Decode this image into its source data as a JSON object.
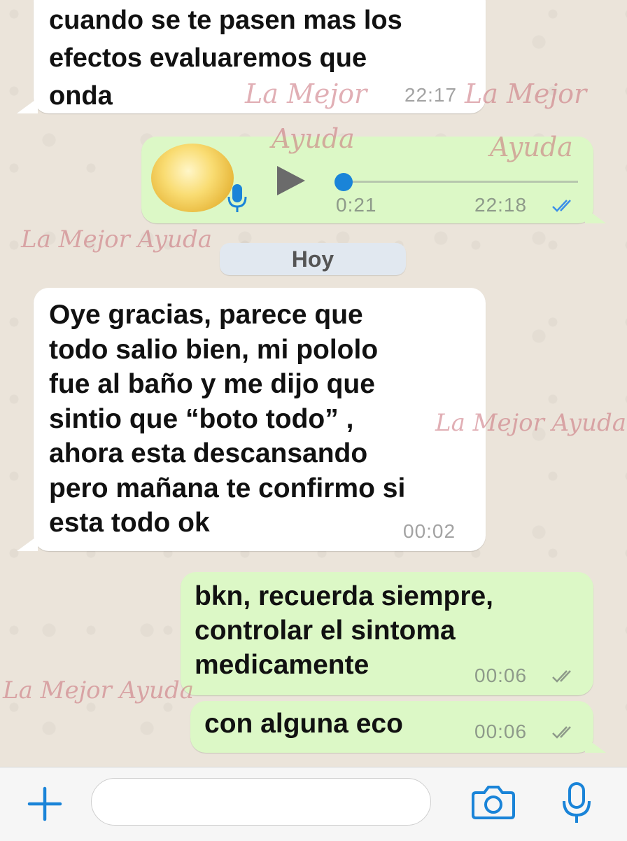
{
  "messages": [
    {
      "text": "cuando se te pasen mas los\nefectos evaluaremos que\nonda",
      "time": "22:17"
    },
    {
      "audio_duration": "0:21",
      "time": "22:18"
    },
    {
      "text": "Oye gracias, parece que\ntodo salio bien, mi pololo\nfue al baño y me dijo que\nsintio que “boto todo” ,\nahora esta descansando\npero mañana te confirmo si\nesta todo ok",
      "time": "00:02"
    },
    {
      "text": "bkn, recuerda siempre,\ncontrolar el sintoma\nmedicamente",
      "time": "00:06"
    },
    {
      "text": "con alguna eco",
      "time": "00:06"
    }
  ],
  "day_separator": "Hoy",
  "watermark": {
    "line1": "La Mejor",
    "line2": "Ayuda",
    "full": "La Mejor Ayuda"
  },
  "input": {
    "placeholder": ""
  },
  "icons": {
    "add": "plus-icon",
    "camera": "camera-icon",
    "mic": "microphone-icon",
    "play": "play-icon",
    "read_receipt": "double-check-icon"
  },
  "colors": {
    "incoming_bubble": "#ffffff",
    "outgoing_bubble": "#dcf8c6",
    "accent_blue": "#1a84d8",
    "read_blue": "#3b8ee8"
  }
}
